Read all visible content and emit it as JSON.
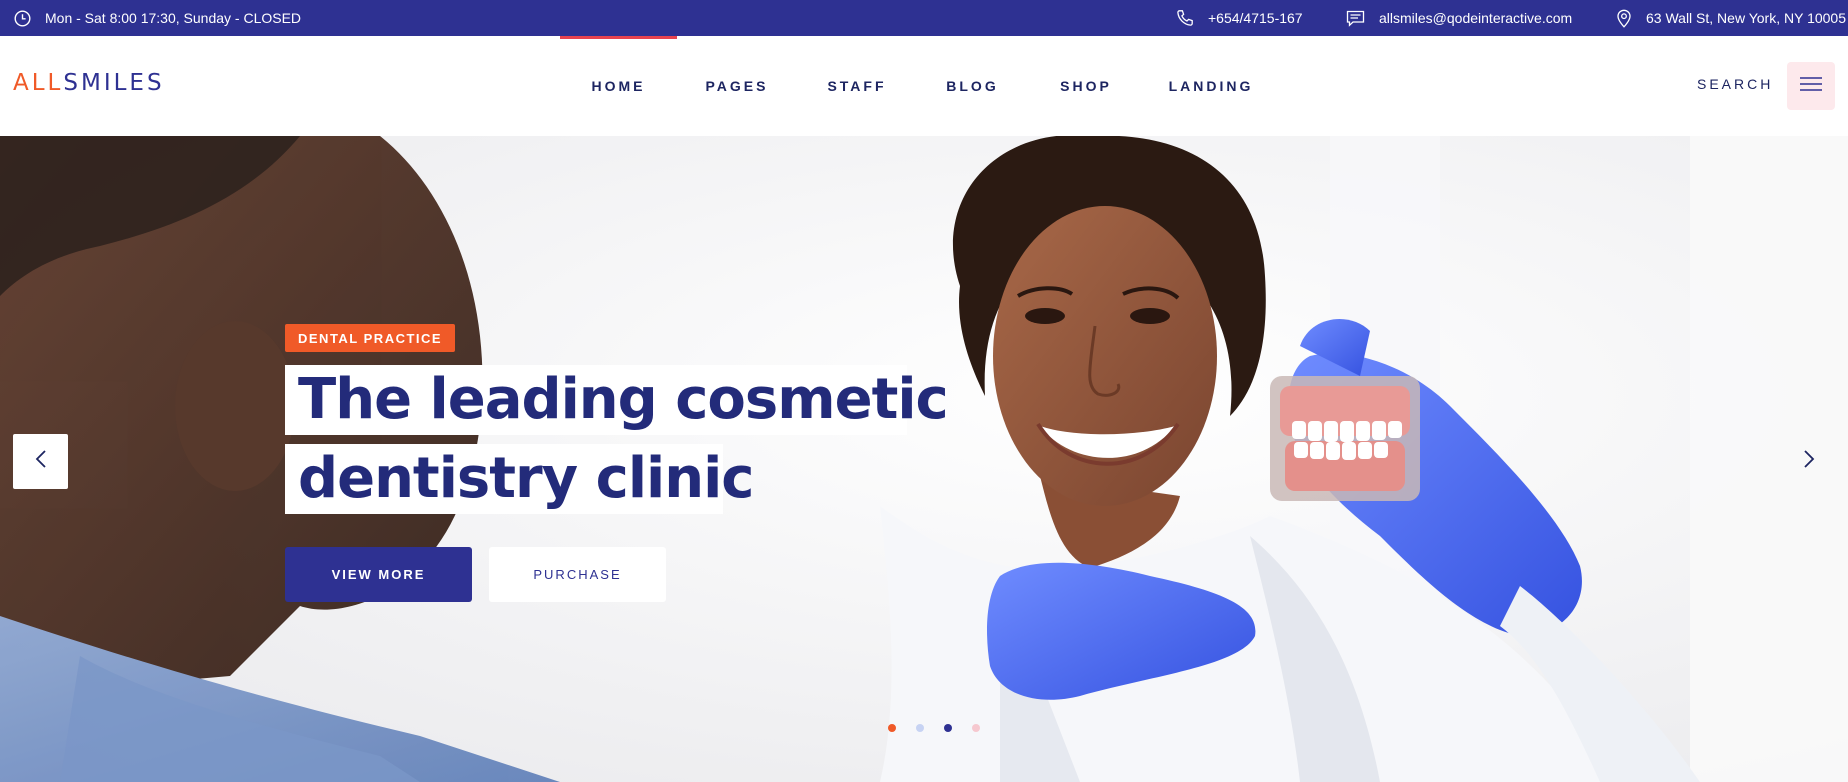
{
  "topbar": {
    "hours": "Mon - Sat 8:00 17:30, Sunday - CLOSED",
    "phone": "+654/4715-167",
    "email": "allsmiles@qodeinteractive.com",
    "address": "63 Wall St, New York, NY 10005"
  },
  "logo": {
    "part1": "ALL",
    "part2": "SMILES"
  },
  "nav": {
    "items": [
      {
        "label": "HOME"
      },
      {
        "label": "PAGES"
      },
      {
        "label": "STAFF"
      },
      {
        "label": "BLOG"
      },
      {
        "label": "SHOP"
      },
      {
        "label": "LANDING"
      }
    ],
    "active_index": 0
  },
  "header": {
    "search_label": "SEARCH"
  },
  "hero": {
    "tag": "DENTAL PRACTICE",
    "headline_line1": "The leading cosmetic",
    "headline_line2": "dentistry clinic",
    "primary_button": "VIEW MORE",
    "secondary_button": "PURCHASE",
    "slides": 4,
    "active_slide": 0
  },
  "colors": {
    "brand_blue": "#2e3192",
    "accent_orange": "#f05a28",
    "active_bar": "#e8434f",
    "menu_bg": "#fde9ec"
  }
}
